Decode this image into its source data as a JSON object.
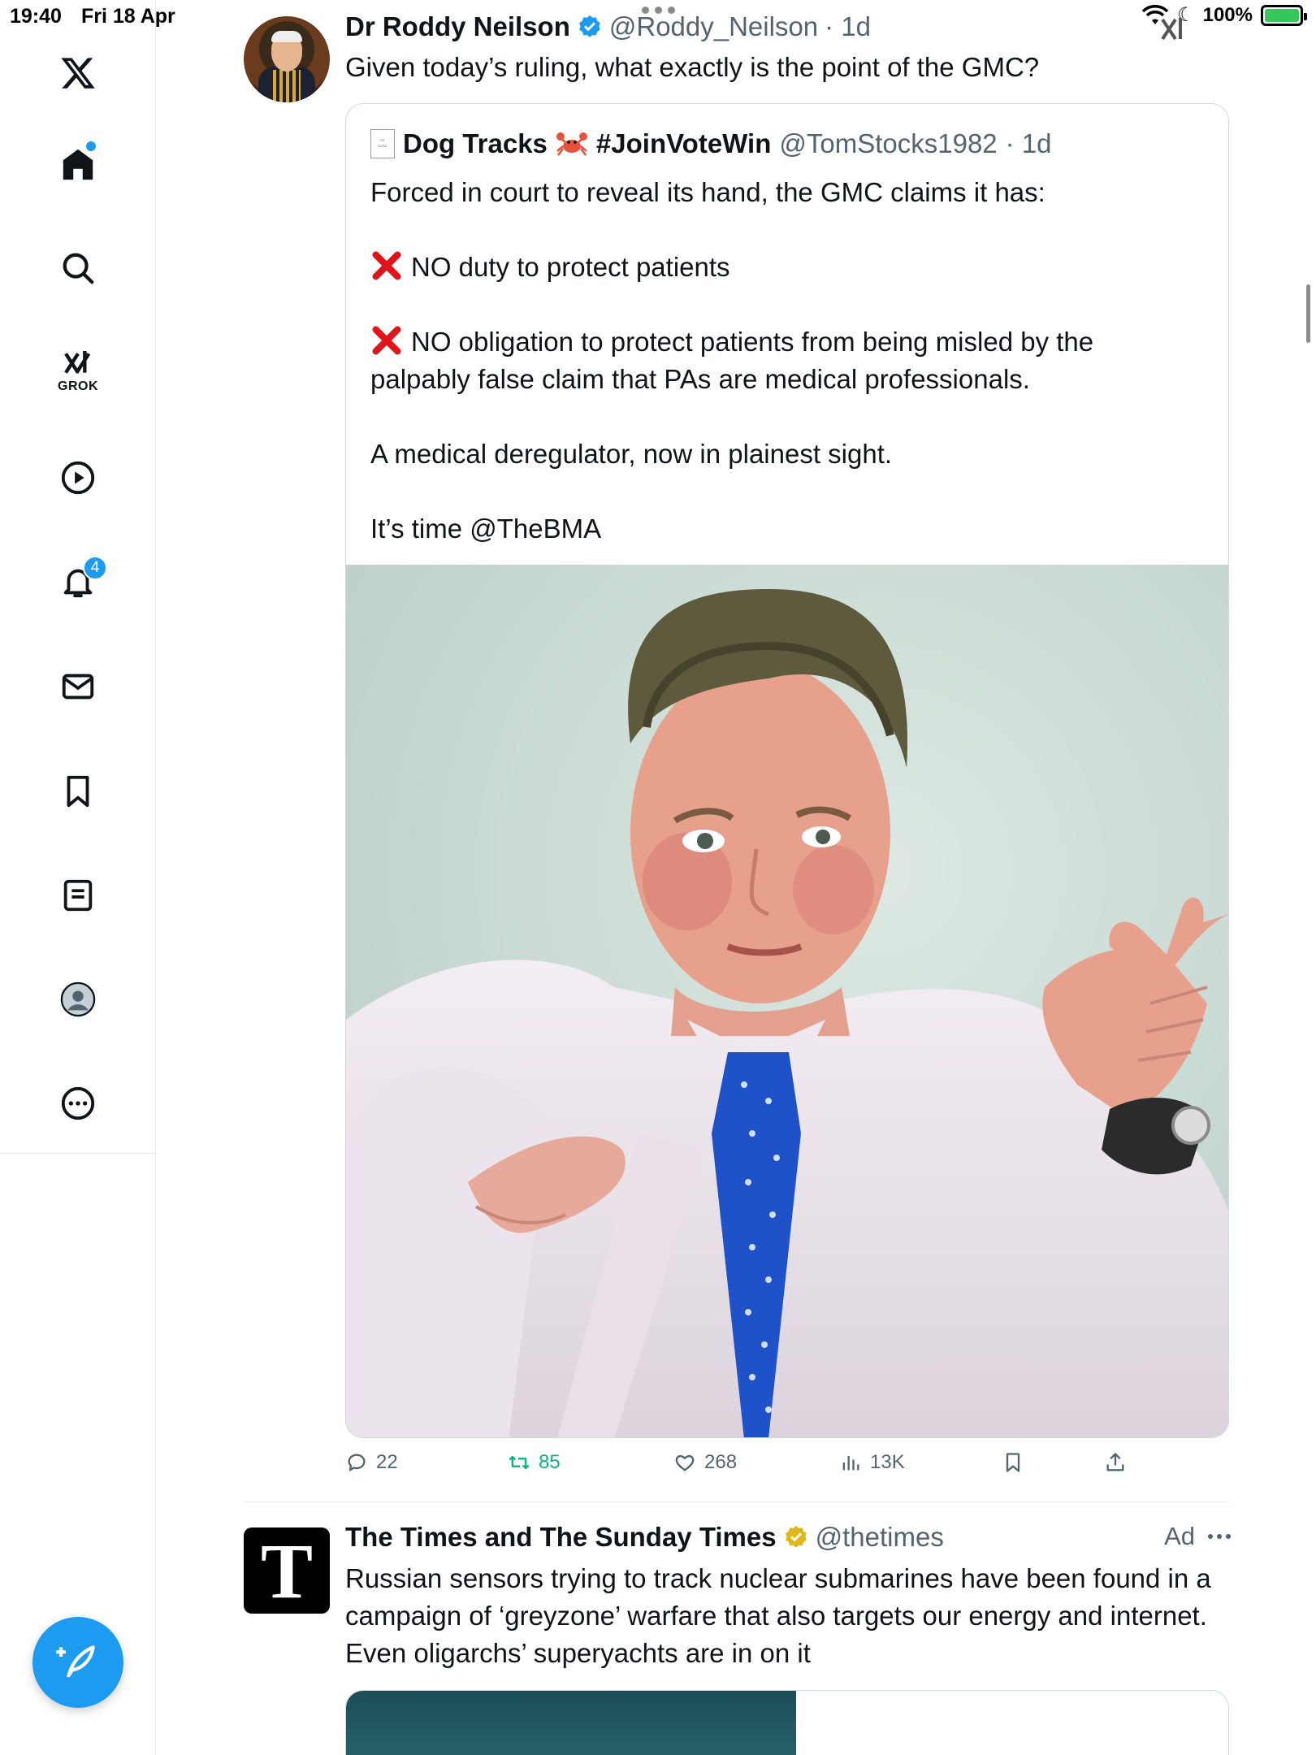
{
  "status_bar": {
    "time": "19:40",
    "date": "Fri 18 Apr",
    "battery": "100%"
  },
  "sidebar": {
    "items": [
      {
        "name": "x-logo",
        "label": ""
      },
      {
        "name": "home",
        "label": ""
      },
      {
        "name": "search",
        "label": ""
      },
      {
        "name": "grok",
        "label": "GROK"
      },
      {
        "name": "video",
        "label": ""
      },
      {
        "name": "notifications",
        "label": "",
        "badge": "4"
      },
      {
        "name": "messages",
        "label": ""
      },
      {
        "name": "bookmarks",
        "label": ""
      },
      {
        "name": "lists",
        "label": ""
      },
      {
        "name": "profile",
        "label": ""
      },
      {
        "name": "more",
        "label": ""
      }
    ]
  },
  "tweet1": {
    "name": "Dr Roddy Neilson",
    "handle": "@Roddy_Neilson",
    "time": "· 1d",
    "text": "Given today’s ruling, what exactly is the point of the GMC?",
    "quote": {
      "name": "Dog Tracks",
      "hashtag": "#JoinVoteWin",
      "handle": "@TomStocks1982",
      "time": "· 1d",
      "lines": {
        "l1": "Forced in court to reveal its hand, the GMC claims it has:",
        "l2": "NO duty to protect patients",
        "l3": "NO obligation to protect patients from being misled by the palpably false claim that PAs are medical professionals.",
        "l4": "A medical deregulator, now in plainest sight.",
        "l5": "It’s time @TheBMA"
      }
    },
    "actions": {
      "replies": "22",
      "retweets": "85",
      "likes": "268",
      "views": "13K"
    }
  },
  "tweet2": {
    "name": "The Times and The Sunday Times",
    "handle": "@thetimes",
    "ad": "Ad",
    "avatar_letter": "T",
    "text": "Russian sensors trying to track nuclear submarines have been found in a campaign of ‘greyzone’ warfare that also targets our energy and internet. Even oligarchs’ superyachts are in on it"
  },
  "colors": {
    "accent": "#1d9bf0",
    "retweet": "#00ba7c",
    "muted": "#536471",
    "verified_gold": "#e2b719",
    "x_mark": "#e0151b"
  }
}
